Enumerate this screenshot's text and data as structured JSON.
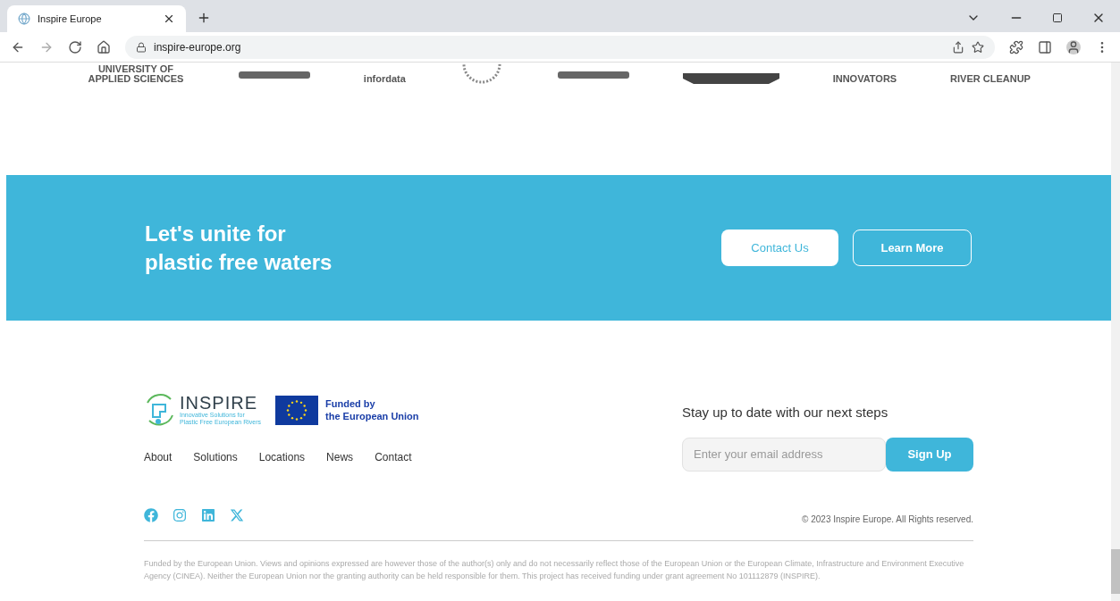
{
  "browser": {
    "tab_title": "Inspire Europe",
    "url": "inspire-europe.org"
  },
  "partner_logos": [
    {
      "kind": "text",
      "text": "UNIVERSITY OF APPLIED SCIENCES"
    },
    {
      "kind": "mark"
    },
    {
      "kind": "text",
      "text": "infordata"
    },
    {
      "kind": "seal"
    },
    {
      "kind": "mark"
    },
    {
      "kind": "bar"
    },
    {
      "kind": "text",
      "text": "INNOVATORS"
    },
    {
      "kind": "text",
      "text": "RIVER CLEANUP"
    }
  ],
  "banner": {
    "heading_lines": [
      "Let's unite for",
      "plastic free waters"
    ],
    "buttons": [
      {
        "label": "Contact Us",
        "kind": "solid"
      },
      {
        "label": "Learn More",
        "kind": "outline"
      }
    ]
  },
  "footer": {
    "logo": {
      "name": "INSPIRE",
      "tagline_lines": [
        "Innovative Solutions for",
        "Plastic Free European Rivers"
      ]
    },
    "eu_badge": {
      "lines": [
        "Funded by",
        "the European Union"
      ]
    },
    "nav": [
      "About",
      "Solutions",
      "Locations",
      "News",
      "Contact"
    ],
    "social": [
      {
        "kind": "facebook"
      },
      {
        "kind": "instagram"
      },
      {
        "kind": "linkedin"
      },
      {
        "kind": "x"
      }
    ],
    "newsletter": {
      "heading": "Stay up to date with our next steps",
      "placeholder": "Enter your email address",
      "button": "Sign Up"
    },
    "copyright": "© 2023 Inspire Europe. All Rights reserved.",
    "disclaimer": "Funded by the European Union. Views and opinions expressed are however those of the author(s) only and do not necessarily reflect those of the European Union or the European Climate, Infrastructure and Environment Executive Agency (CINEA). Neither the European Union nor the granting authority can be held responsible for them. This project has received funding under grant agreement No 101112879 (INSPIRE)."
  }
}
